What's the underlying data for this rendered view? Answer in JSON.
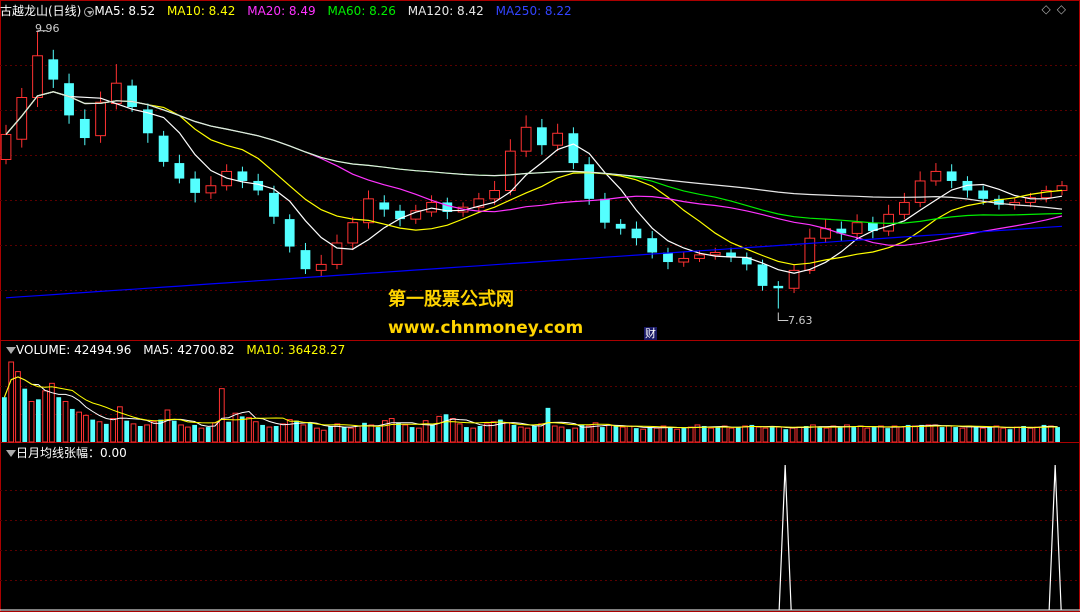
{
  "colors": {
    "up": "#ff3232",
    "down": "#54ffff",
    "ma5": "#ffffff",
    "ma10": "#ffff00",
    "ma20": "#ff33ff",
    "ma60": "#00ee00",
    "ma120": "#e6e6e6",
    "ma250": "#0000ff",
    "watermark": "#ffd400",
    "frame": "#aa0000"
  },
  "main_legend": {
    "title": "古越龙山(日线)",
    "ma5": "MA5: 8.52",
    "ma10": "MA10: 8.42",
    "ma20": "MA20: 8.49",
    "ma60": "MA60: 8.26",
    "ma120": "MA120: 8.42",
    "ma250": "MA250: 8.22"
  },
  "volume_legend": {
    "vol": "VOLUME: 42494.96",
    "ma5": "MA5: 42700.82",
    "ma10": "MA10: 36428.27"
  },
  "indicator_legend": {
    "label": "日月均线张幅：0.00"
  },
  "price_annotations": {
    "high": "9.96",
    "low": "7.63",
    "marker": "财"
  },
  "watermark": {
    "line1": "第一股票公式网",
    "line2": "www.chnmoney.com"
  },
  "corner_icons": [
    "diamond-icon",
    "diamond-icon"
  ],
  "chart_data": {
    "type": "candlestick",
    "price_range": [
      7.45,
      10.05
    ],
    "high_price": 9.96,
    "low_price": 7.63,
    "candles": [
      [
        8.88,
        9.09,
        9.17,
        8.84
      ],
      [
        9.05,
        9.4,
        9.48,
        8.98
      ],
      [
        9.4,
        9.75,
        9.96,
        9.32
      ],
      [
        9.72,
        9.55,
        9.8,
        9.48
      ],
      [
        9.52,
        9.25,
        9.6,
        9.18
      ],
      [
        9.22,
        9.06,
        9.3,
        9.0
      ],
      [
        9.08,
        9.36,
        9.45,
        9.02
      ],
      [
        9.35,
        9.52,
        9.68,
        9.3
      ],
      [
        9.5,
        9.32,
        9.55,
        9.28
      ],
      [
        9.3,
        9.1,
        9.35,
        9.02
      ],
      [
        9.08,
        8.86,
        9.12,
        8.82
      ],
      [
        8.85,
        8.72,
        8.92,
        8.68
      ],
      [
        8.72,
        8.6,
        8.78,
        8.52
      ],
      [
        8.6,
        8.66,
        8.74,
        8.55
      ],
      [
        8.66,
        8.78,
        8.84,
        8.62
      ],
      [
        8.78,
        8.7,
        8.82,
        8.64
      ],
      [
        8.7,
        8.62,
        8.76,
        8.58
      ],
      [
        8.6,
        8.4,
        8.66,
        8.34
      ],
      [
        8.38,
        8.15,
        8.42,
        8.1
      ],
      [
        8.12,
        7.96,
        8.18,
        7.92
      ],
      [
        7.95,
        8.0,
        8.08,
        7.9
      ],
      [
        8.0,
        8.18,
        8.25,
        7.96
      ],
      [
        8.18,
        8.35,
        8.4,
        8.12
      ],
      [
        8.35,
        8.55,
        8.62,
        8.3
      ],
      [
        8.52,
        8.46,
        8.58,
        8.4
      ],
      [
        8.45,
        8.38,
        8.5,
        8.32
      ],
      [
        8.38,
        8.45,
        8.5,
        8.34
      ],
      [
        8.44,
        8.52,
        8.58,
        8.4
      ],
      [
        8.52,
        8.44,
        8.56,
        8.38
      ],
      [
        8.44,
        8.48,
        8.52,
        8.4
      ],
      [
        8.48,
        8.55,
        8.6,
        8.44
      ],
      [
        8.55,
        8.62,
        8.7,
        8.5
      ],
      [
        8.62,
        8.95,
        9.05,
        8.58
      ],
      [
        8.95,
        9.15,
        9.25,
        8.9
      ],
      [
        9.15,
        9.0,
        9.22,
        8.92
      ],
      [
        9.0,
        9.1,
        9.18,
        8.95
      ],
      [
        9.1,
        8.85,
        9.15,
        8.8
      ],
      [
        8.84,
        8.55,
        8.9,
        8.5
      ],
      [
        8.55,
        8.35,
        8.6,
        8.3
      ],
      [
        8.34,
        8.3,
        8.38,
        8.25
      ],
      [
        8.3,
        8.22,
        8.36,
        8.16
      ],
      [
        8.22,
        8.1,
        8.28,
        8.05
      ],
      [
        8.1,
        8.02,
        8.14,
        7.96
      ],
      [
        8.02,
        8.05,
        8.1,
        7.98
      ],
      [
        8.05,
        8.08,
        8.12,
        8.02
      ],
      [
        8.08,
        8.1,
        8.14,
        8.04
      ],
      [
        8.1,
        8.06,
        8.14,
        8.02
      ],
      [
        8.06,
        8.0,
        8.1,
        7.95
      ],
      [
        8.0,
        7.82,
        8.04,
        7.78
      ],
      [
        7.82,
        7.8,
        7.86,
        7.63
      ],
      [
        7.8,
        7.95,
        8.0,
        7.76
      ],
      [
        7.95,
        8.22,
        8.3,
        7.92
      ],
      [
        8.22,
        8.3,
        8.38,
        8.18
      ],
      [
        8.3,
        8.26,
        8.36,
        8.2
      ],
      [
        8.26,
        8.35,
        8.42,
        8.22
      ],
      [
        8.35,
        8.28,
        8.4,
        8.22
      ],
      [
        8.28,
        8.42,
        8.5,
        8.24
      ],
      [
        8.42,
        8.52,
        8.6,
        8.38
      ],
      [
        8.52,
        8.7,
        8.78,
        8.48
      ],
      [
        8.7,
        8.78,
        8.85,
        8.66
      ],
      [
        8.78,
        8.7,
        8.84,
        8.64
      ],
      [
        8.7,
        8.62,
        8.74,
        8.56
      ],
      [
        8.62,
        8.55,
        8.66,
        8.5
      ],
      [
        8.55,
        8.5,
        8.58,
        8.46
      ],
      [
        8.5,
        8.52,
        8.56,
        8.46
      ],
      [
        8.52,
        8.56,
        8.6,
        8.48
      ],
      [
        8.56,
        8.62,
        8.66,
        8.52
      ],
      [
        8.62,
        8.66,
        8.7,
        8.58
      ]
    ],
    "volume": [
      42,
      75,
      66,
      50,
      38,
      40,
      48,
      55,
      42,
      38,
      31,
      28,
      25,
      21,
      19,
      17,
      22,
      33,
      20,
      17,
      15,
      16,
      19,
      21,
      30,
      20,
      16,
      14,
      16,
      13,
      14,
      18,
      50,
      19,
      27,
      24,
      23,
      19,
      16,
      14,
      15,
      17,
      21,
      20,
      16,
      18,
      13,
      11,
      15,
      17,
      14,
      13,
      15,
      18,
      16,
      14,
      20,
      22,
      18,
      16,
      14,
      13,
      20,
      16,
      24,
      26,
      22,
      17,
      14,
      13,
      15,
      17,
      19,
      21,
      18,
      16,
      14,
      13,
      15,
      17,
      32,
      15,
      14,
      12,
      13,
      16,
      15,
      18,
      14,
      16,
      15,
      14,
      15,
      13,
      12,
      14,
      13,
      15,
      14,
      12,
      13,
      14,
      16,
      15,
      13,
      14,
      15,
      13,
      14,
      15,
      16,
      14,
      13,
      15,
      14,
      12,
      13,
      14,
      15,
      16,
      14,
      13,
      15,
      14,
      16,
      14,
      15,
      13,
      14,
      15,
      13,
      15,
      14,
      16,
      15,
      16,
      16,
      16,
      14,
      15,
      14,
      13,
      15,
      14,
      13,
      14,
      15,
      13,
      12,
      14,
      15,
      13,
      14,
      16,
      15,
      14
    ],
    "indicator": {
      "label": "日月均线张幅",
      "value": 0.0,
      "spikes_at": [
        0.727,
        0.977
      ]
    }
  }
}
